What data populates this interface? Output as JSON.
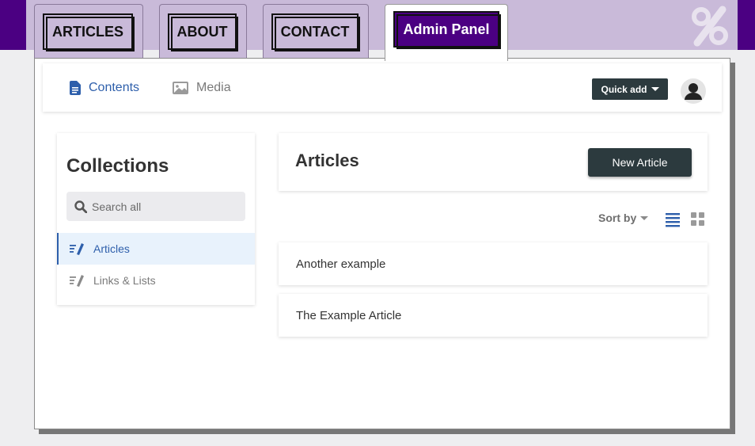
{
  "site_nav": {
    "tabs": [
      {
        "label": "ARTICLES"
      },
      {
        "label": "ABOUT"
      },
      {
        "label": "CONTACT"
      },
      {
        "label": "Admin Panel",
        "active": true
      }
    ],
    "logo_icon": "percent-logo-icon"
  },
  "subnav": {
    "contents_label": "Contents",
    "media_label": "Media",
    "quick_add_label": "Quick add"
  },
  "collections": {
    "title": "Collections",
    "search_placeholder": "Search all",
    "items": [
      {
        "label": "Articles",
        "active": true,
        "icon": "edit-list-icon"
      },
      {
        "label": "Links & Lists",
        "active": false,
        "icon": "edit-list-icon"
      }
    ]
  },
  "main": {
    "title": "Articles",
    "new_button_label": "New Article",
    "sort_label": "Sort by",
    "view_modes": [
      "list",
      "grid"
    ],
    "active_view": "list",
    "entries": [
      {
        "title": "Another example"
      },
      {
        "title": "The Example Article"
      }
    ]
  },
  "colors": {
    "brand_purple": "#4b0082",
    "band_lavender": "#c9bad9",
    "accent_blue": "#2e5fab",
    "dark_button": "#2c3a3e"
  }
}
